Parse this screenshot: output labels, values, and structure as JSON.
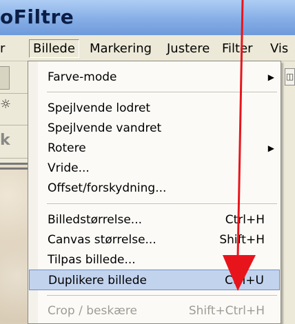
{
  "app": {
    "title": "oFiltre"
  },
  "menubar": {
    "items": [
      "r",
      "Billede",
      "Markering",
      "Justere",
      "Filter",
      "Vis"
    ]
  },
  "toolbar": {
    "glyph_a": "☼",
    "glyph_b": "k"
  },
  "right_icon": {
    "glyph": "◫"
  },
  "menu": {
    "sections": [
      {
        "items": [
          {
            "label": "Farve-mode",
            "submenu": true
          }
        ]
      },
      {
        "items": [
          {
            "label": "Spejlvende lodret"
          },
          {
            "label": "Spejlvende vandret"
          },
          {
            "label": "Rotere",
            "submenu": true
          },
          {
            "label": "Vride..."
          },
          {
            "label": "Offset/forskydning..."
          }
        ]
      },
      {
        "items": [
          {
            "label": "Billedstørrelse...",
            "shortcut": "Ctrl+H"
          },
          {
            "label": "Canvas størrelse...",
            "shortcut": "Shift+H"
          },
          {
            "label": "Tilpas billede..."
          },
          {
            "label": "Duplikere billede",
            "shortcut": "Ctrl+U",
            "highlighted": true
          }
        ]
      },
      {
        "items": [
          {
            "label": "Crop / beskære",
            "shortcut": "Shift+Ctrl+H",
            "disabled": true
          }
        ]
      }
    ]
  },
  "colors": {
    "annotation_arrow": "#e8141c",
    "highlight": "#c2d3ee",
    "menubar": "#ece9d8"
  }
}
